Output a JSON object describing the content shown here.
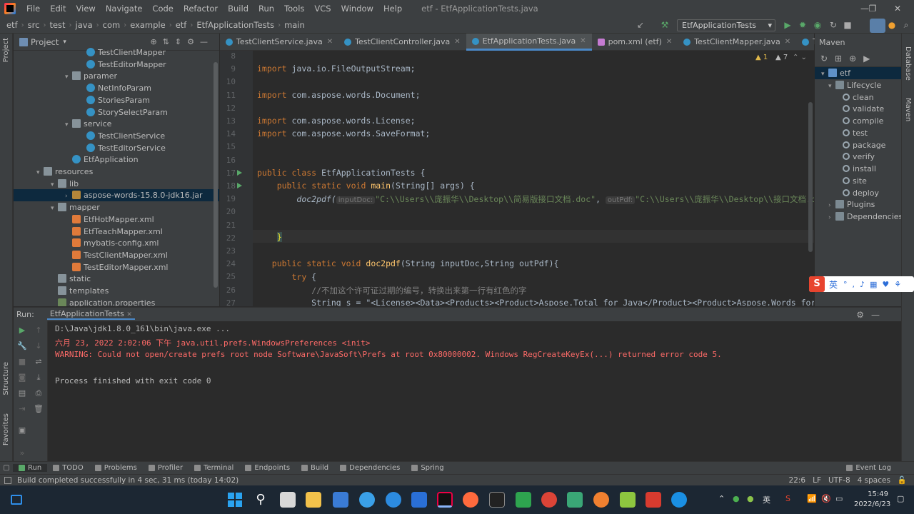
{
  "window": {
    "title": "etf - EtfApplicationTests.java",
    "menu": [
      "File",
      "Edit",
      "View",
      "Navigate",
      "Code",
      "Refactor",
      "Build",
      "Run",
      "Tools",
      "VCS",
      "Window",
      "Help"
    ],
    "controls": {
      "minimize": "—",
      "maximize": "❐",
      "close": "✕"
    }
  },
  "breadcrumb": [
    "etf",
    "src",
    "test",
    "java",
    "com",
    "example",
    "etf",
    "EtfApplicationTests",
    "main"
  ],
  "run_config": "EtfApplicationTests",
  "project": {
    "title": "Project",
    "items": [
      {
        "label": "TestClientMapper",
        "indent": 9,
        "type": "class",
        "arrow": ""
      },
      {
        "label": "TestEditorMapper",
        "indent": 9,
        "type": "class",
        "arrow": ""
      },
      {
        "label": "paramer",
        "indent": 7,
        "type": "folder",
        "arrow": "▾"
      },
      {
        "label": "NetInfoParam",
        "indent": 9,
        "type": "class",
        "arrow": ""
      },
      {
        "label": "StoriesParam",
        "indent": 9,
        "type": "class",
        "arrow": ""
      },
      {
        "label": "StorySelectParam",
        "indent": 9,
        "type": "class",
        "arrow": ""
      },
      {
        "label": "service",
        "indent": 7,
        "type": "folder",
        "arrow": "▾"
      },
      {
        "label": "TestClientService",
        "indent": 9,
        "type": "class",
        "arrow": ""
      },
      {
        "label": "TestEditorService",
        "indent": 9,
        "type": "class",
        "arrow": ""
      },
      {
        "label": "EtfApplication",
        "indent": 7,
        "type": "class",
        "arrow": ""
      },
      {
        "label": "resources",
        "indent": 3,
        "type": "folder",
        "arrow": "▾"
      },
      {
        "label": "lib",
        "indent": 5,
        "type": "folder",
        "arrow": "▾"
      },
      {
        "label": "aspose-words-15.8.0-jdk16.jar",
        "indent": 7,
        "type": "jar",
        "arrow": "›",
        "selected": true
      },
      {
        "label": "mapper",
        "indent": 5,
        "type": "folder",
        "arrow": "▾"
      },
      {
        "label": "EtfHotMapper.xml",
        "indent": 7,
        "type": "xml",
        "arrow": ""
      },
      {
        "label": "EtfTeachMapper.xml",
        "indent": 7,
        "type": "xml",
        "arrow": ""
      },
      {
        "label": "mybatis-config.xml",
        "indent": 7,
        "type": "xml",
        "arrow": ""
      },
      {
        "label": "TestClientMapper.xml",
        "indent": 7,
        "type": "xml",
        "arrow": ""
      },
      {
        "label": "TestEditorMapper.xml",
        "indent": 7,
        "type": "xml",
        "arrow": ""
      },
      {
        "label": "static",
        "indent": 5,
        "type": "folder",
        "arrow": ""
      },
      {
        "label": "templates",
        "indent": 5,
        "type": "folder",
        "arrow": ""
      },
      {
        "label": "application.properties",
        "indent": 5,
        "type": "prop",
        "arrow": ""
      }
    ]
  },
  "tabs": [
    {
      "label": "TestClientService.java",
      "icon": "class"
    },
    {
      "label": "TestClientController.java",
      "icon": "class"
    },
    {
      "label": "EtfApplicationTests.java",
      "icon": "class",
      "active": true
    },
    {
      "label": "pom.xml (etf)",
      "icon": "maven"
    },
    {
      "label": "TestClientMapper.java",
      "icon": "class"
    },
    {
      "label": "TestClientM",
      "icon": "class"
    }
  ],
  "editor": {
    "inspections": {
      "warnings": "▲ 1",
      "weak": "▲ 7"
    },
    "line_numbers": [
      "8",
      "9",
      "10",
      "11",
      "12",
      "13",
      "14",
      "15",
      "16",
      "17",
      "18",
      "19",
      "20",
      "21",
      "22",
      "23",
      "24",
      "25",
      "26",
      "27"
    ],
    "import1": "java.io.FileOutputStream;",
    "import2": "com.aspose.words.Document;",
    "import3": "com.aspose.words.License;",
    "import4": "com.aspose.words.SaveFormat;",
    "kw_import": "import",
    "kw_public": "public",
    "kw_class": "class",
    "kw_static": "static",
    "kw_void": "void",
    "kw_try": "try",
    "class_name": "EtfApplicationTests",
    "main_sig": "(String[] args) {",
    "main_fn": "main",
    "call_fn": "doc2pdf(",
    "hint1": "inputDoc:",
    "arg1": "\"C:\\\\Users\\\\庞振华\\\\Desktop\\\\简易版接口文档.doc\"",
    "hint2": "outPdf:",
    "arg2": "\"C:\\\\Users\\\\庞振华\\\\Desktop\\\\接口文档.pdf\")",
    "close_brace": "}",
    "doc2pdf_fn": "doc2pdf",
    "doc2pdf_sig": "(String inputDoc,String outPdf){",
    "comment": "//不加这个许可证过期的编号，转换出来第一行有红色的字",
    "line27": "String s = \"<License><Data><Products><Product>Aspose.Total for Java</Product><Product>Aspose.Words for Jav"
  },
  "maven": {
    "title": "Maven",
    "items": [
      {
        "label": "etf",
        "indent": 1,
        "arrow": "▾",
        "type": "project",
        "selected": true
      },
      {
        "label": "Lifecycle",
        "indent": 3,
        "arrow": "▾",
        "type": "folder"
      },
      {
        "label": "clean",
        "indent": 5,
        "arrow": "",
        "type": "gear"
      },
      {
        "label": "validate",
        "indent": 5,
        "arrow": "",
        "type": "gear"
      },
      {
        "label": "compile",
        "indent": 5,
        "arrow": "",
        "type": "gear"
      },
      {
        "label": "test",
        "indent": 5,
        "arrow": "",
        "type": "gear"
      },
      {
        "label": "package",
        "indent": 5,
        "arrow": "",
        "type": "gear"
      },
      {
        "label": "verify",
        "indent": 5,
        "arrow": "",
        "type": "gear"
      },
      {
        "label": "install",
        "indent": 5,
        "arrow": "",
        "type": "gear"
      },
      {
        "label": "site",
        "indent": 5,
        "arrow": "",
        "type": "gear"
      },
      {
        "label": "deploy",
        "indent": 5,
        "arrow": "",
        "type": "gear"
      },
      {
        "label": "Plugins",
        "indent": 3,
        "arrow": "›",
        "type": "folder"
      },
      {
        "label": "Dependencies",
        "indent": 3,
        "arrow": "›",
        "type": "folder"
      }
    ]
  },
  "side_stripes": {
    "left_top": "Project",
    "left_structure": "Structure",
    "left_favorites": "Favorites",
    "right_database": "Database",
    "right_maven": "Maven"
  },
  "run_panel": {
    "label": "Run:",
    "tab": "EtfApplicationTests",
    "lines": [
      {
        "text": "D:\\Java\\jdk1.8.0_161\\bin\\java.exe ...",
        "color": "#bbbbbb"
      },
      {
        "text": "六月 23, 2022 2:02:06 下午 java.util.prefs.WindowsPreferences <init>",
        "color": "#ff6b68"
      },
      {
        "text": "WARNING: Could not open/create prefs root node Software\\JavaSoft\\Prefs at root 0x80000002. Windows RegCreateKeyEx(...) returned error code 5.",
        "color": "#ff6b68"
      },
      {
        "text": "",
        "color": "#bbbbbb"
      },
      {
        "text": "Process finished with exit code 0",
        "color": "#bbbbbb"
      }
    ]
  },
  "bottom_tools": [
    "Run",
    "TODO",
    "Problems",
    "Profiler",
    "Terminal",
    "Endpoints",
    "Build",
    "Dependencies",
    "Spring"
  ],
  "event_log": "Event Log",
  "status": {
    "message": "Build completed successfully in 4 sec, 31 ms (today 14:02)",
    "position": "22:6",
    "line_sep": "LF",
    "encoding": "UTF-8",
    "indent": "4 spaces"
  },
  "ime": {
    "mode": "英"
  },
  "taskbar": {
    "time": "15:49",
    "date": "2022/6/23",
    "lang": "英"
  }
}
